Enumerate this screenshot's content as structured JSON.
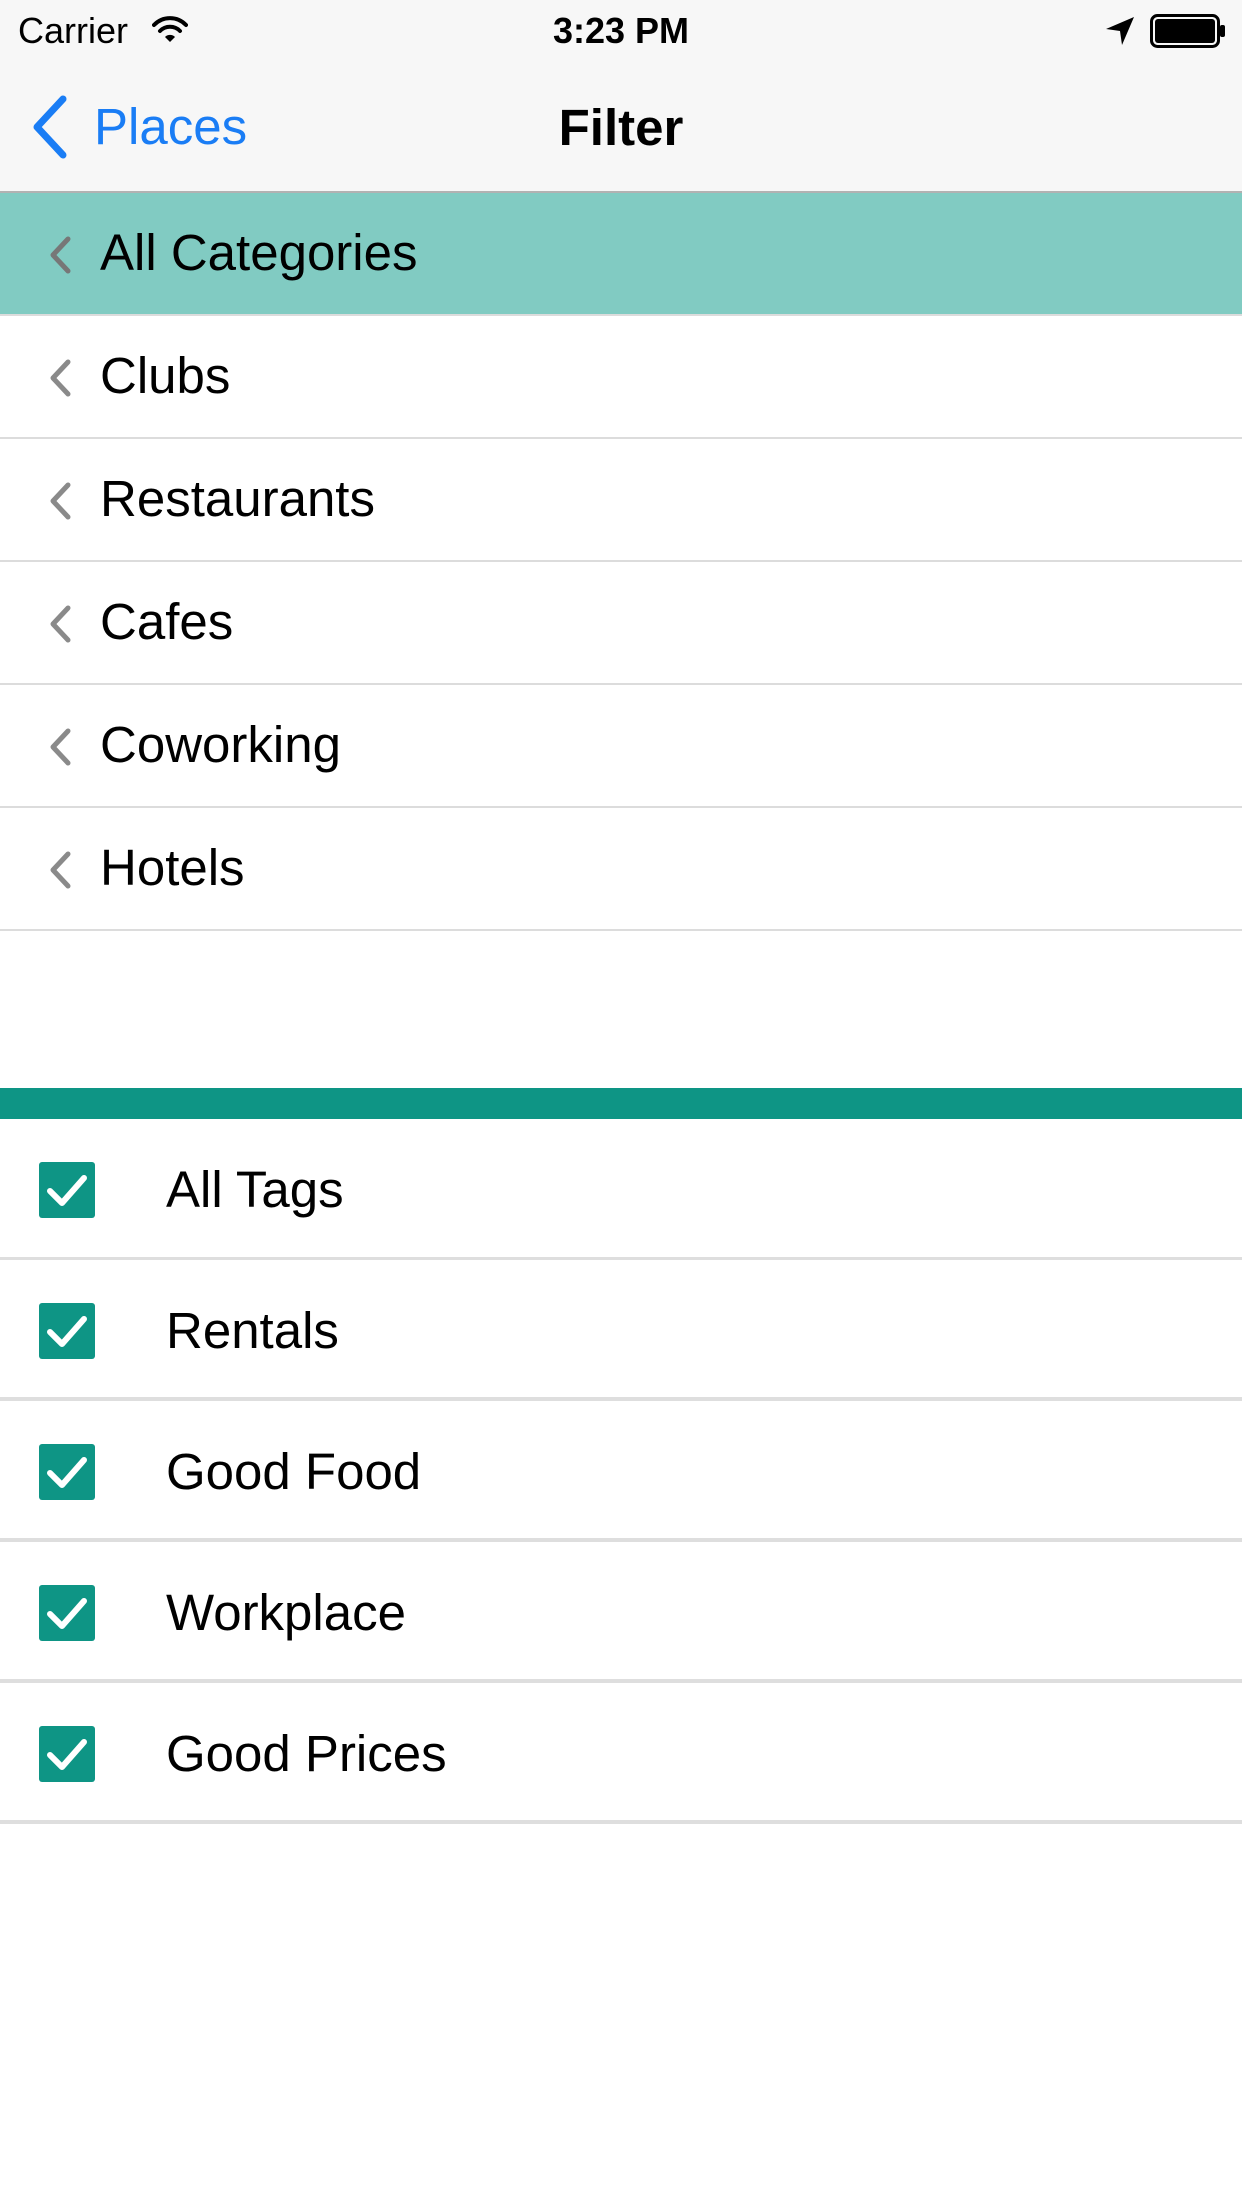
{
  "status_bar": {
    "carrier": "Carrier",
    "time": "3:23 PM",
    "icons": [
      "wifi-icon",
      "location-arrow-icon",
      "battery-icon"
    ]
  },
  "nav": {
    "back_label": "Places",
    "title": "Filter",
    "back_icon": "chevron-left-icon"
  },
  "categories": {
    "selected_index": 0,
    "items": [
      {
        "label": "All Categories"
      },
      {
        "label": "Clubs"
      },
      {
        "label": "Restaurants"
      },
      {
        "label": "Cafes"
      },
      {
        "label": "Coworking"
      },
      {
        "label": "Hotels"
      }
    ],
    "row_icon": "chevron-left-icon"
  },
  "tags": {
    "items": [
      {
        "label": "All Tags",
        "checked": true
      },
      {
        "label": "Rentals",
        "checked": true
      },
      {
        "label": "Good Food",
        "checked": true
      },
      {
        "label": "Workplace",
        "checked": true
      },
      {
        "label": "Good Prices",
        "checked": true
      }
    ],
    "checkbox_icon": "checkmark-icon"
  },
  "colors": {
    "accent_blue": "#1a7df5",
    "selected_row": "#81cbc2",
    "teal": "#0e9585",
    "bar_background": "#f7f7f7",
    "separator": "#dcdcdc"
  }
}
